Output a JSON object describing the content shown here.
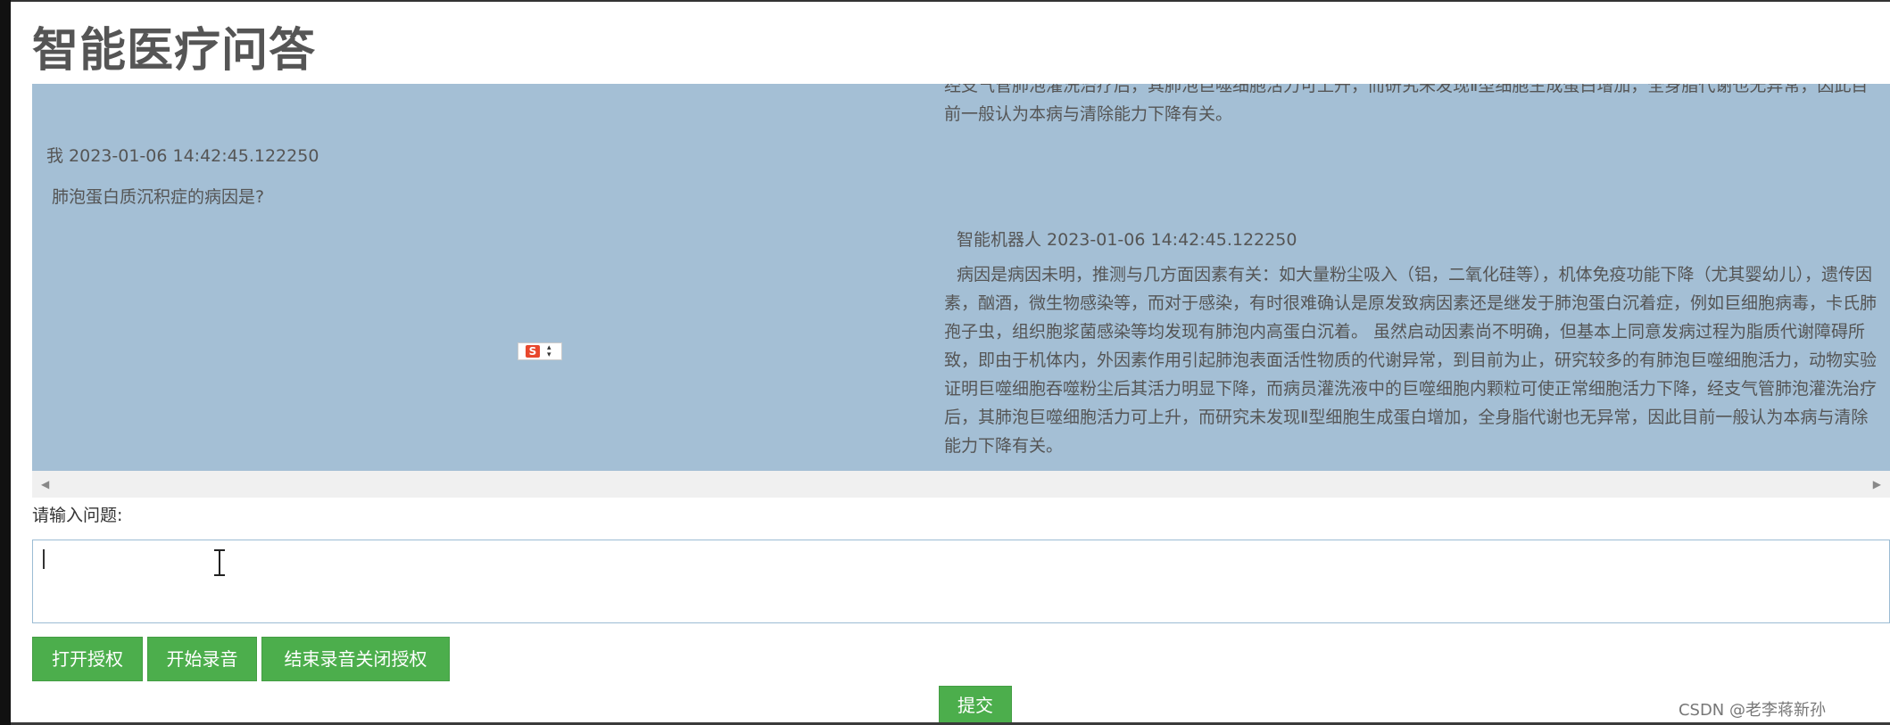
{
  "header": {
    "title": "智能医疗问答"
  },
  "chat": {
    "bot_previous_tail": "经支气管肺泡灌洗治疗后，其肺泡巨噬细胞活力可上升，而研究未发现Ⅱ型细胞生成蛋白增加，全身脂代谢也无异常，因此目前一般认为本病与清除能力下降有关。",
    "user_header": "我 2023-01-06 14:42:45.122250",
    "user_message": "肺泡蛋白质沉积症的病因是?",
    "bot_header": "智能机器人 2023-01-06 14:42:45.122250",
    "bot_message": "病因是病因未明，推测与几方面因素有关：如大量粉尘吸入（铝，二氧化硅等），机体免疫功能下降（尤其婴幼儿），遗传因素，酗酒，微生物感染等，而对于感染，有时很难确认是原发致病因素还是继发于肺泡蛋白沉着症，例如巨细胞病毒，卡氏肺孢子虫，组织胞浆菌感染等均发现有肺泡内高蛋白沉着。 虽然启动因素尚不明确，但基本上同意发病过程为脂质代谢障碍所致，即由于机体内，外因素作用引起肺泡表面活性物质的代谢异常，到目前为止，研究较多的有肺泡巨噬细胞活力，动物实验证明巨噬细胞吞噬粉尘后其活力明显下降，而病员灌洗液中的巨噬细胞内颗粒可使正常细胞活力下降，经支气管肺泡灌洗治疗后，其肺泡巨噬细胞活力可上升，而研究未发现Ⅱ型细胞生成蛋白增加，全身脂代谢也无异常，因此目前一般认为本病与清除能力下降有关。"
  },
  "ime": {
    "badge_letter": "S"
  },
  "input": {
    "label": "请输入问题:",
    "value": ""
  },
  "buttons": {
    "auth": "打开授权",
    "record": "开始录音",
    "stop": "结束录音关闭授权",
    "submit": "提交"
  },
  "watermark": "CSDN @老李蒋新孙",
  "colors": {
    "chat_background": "#a4bfd5",
    "button_green": "#4cae4c",
    "input_border": "#9cbcd4"
  }
}
